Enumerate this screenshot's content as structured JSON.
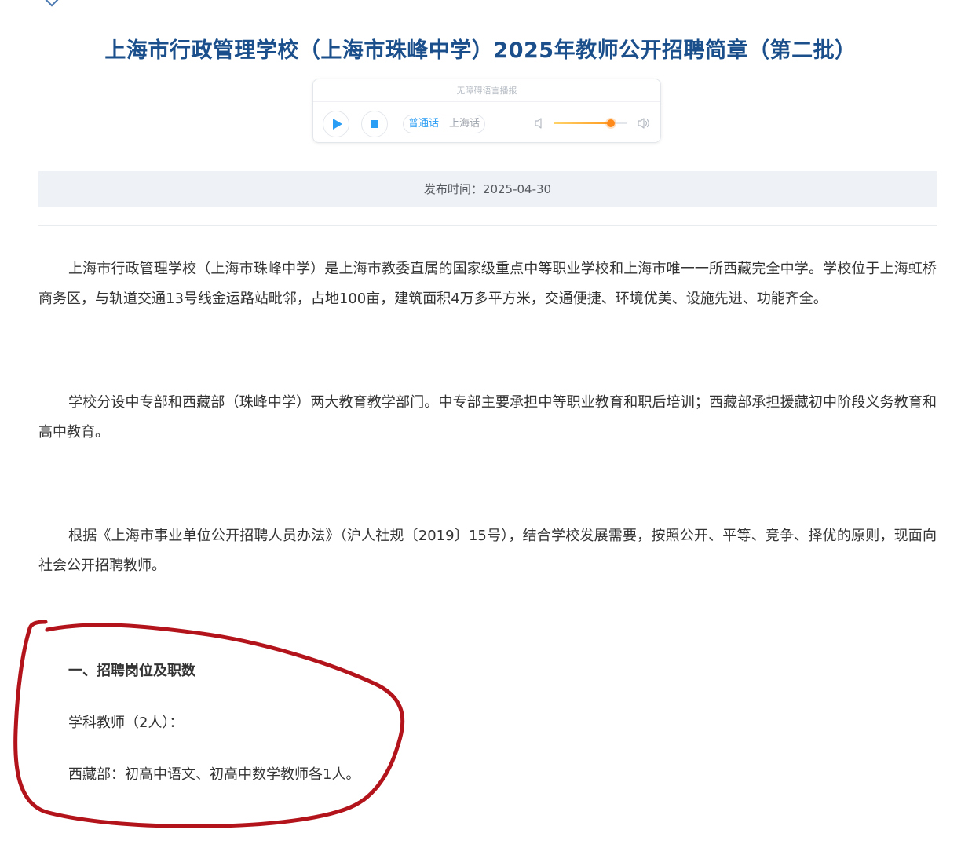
{
  "article": {
    "title": "上海市行政管理学校（上海市珠峰中学）2025年教师公开招聘简章（第二批）"
  },
  "player": {
    "header": "无障碍语言播报",
    "languages": [
      "普通话",
      "上海话"
    ],
    "selected_language": "普通话",
    "volume": 0.78,
    "accent_color": "#2a9df4",
    "slider_color": "#ff8a1a",
    "icons": [
      "play-icon",
      "stop-icon",
      "volume-low-icon",
      "volume-high-icon"
    ]
  },
  "meta": {
    "publish_label": "发布时间：2025-04-30"
  },
  "body": {
    "paragraphs": [
      "上海市行政管理学校（上海市珠峰中学）是上海市教委直属的国家级重点中等职业学校和上海市唯一一所西藏完全中学。学校位于上海虹桥商务区，与轨道交通13号线金运路站毗邻，占地100亩，建筑面积4万多平方米，交通便捷、环境优美、设施先进、功能齐全。",
      "学校分设中专部和西藏部（珠峰中学）两大教育教学部门。中专部主要承担中等职业教育和职后培训；西藏部承担援藏初中阶段义务教育和高中教育。",
      "根据《上海市事业单位公开招聘人员办法》（沪人社规〔2019〕15号），结合学校发展需要，按照公开、平等、竞争、择优的原则，现面向社会公开招聘教师。"
    ],
    "section1": {
      "heading": "一、招聘岗位及职数",
      "lines": [
        "学科教师（2人）：",
        "西藏部：初高中语文、初高中数学教师各1人。"
      ]
    }
  },
  "colors": {
    "title": "#1a4f8c",
    "annotation": "#b3141b",
    "publish_bar": "#eef1f5"
  }
}
